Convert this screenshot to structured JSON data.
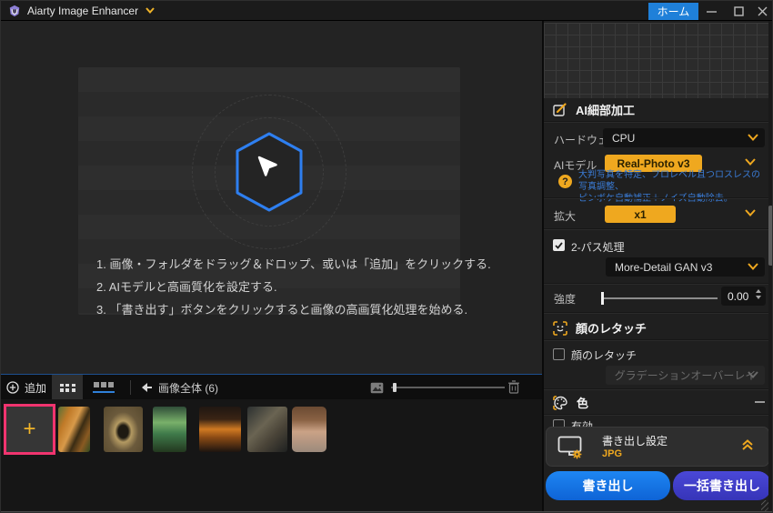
{
  "titlebar": {
    "app_title": "Aiarty Image Enhancer",
    "home_button": "ホーム"
  },
  "dropzone": {
    "instructions": [
      "1. 画像・フォルダをドラッグ＆ドロップ、或いは「追加」をクリックする.",
      "2. AIモデルと高画質化を設定する.",
      "3. 「書き出す」ボタンをクリックすると画像の高画質化処理を始める."
    ]
  },
  "toolbar": {
    "add_label": "追加",
    "view_all_label": "画像全体 (6)"
  },
  "filmstrip": {
    "items": [
      "tiger",
      "butterfly",
      "terrarium-jar",
      "burger",
      "armored-dog",
      "portrait-girl"
    ]
  },
  "sidebar": {
    "ai": {
      "title": "AI細部加工",
      "hardware_label": "ハードウェア",
      "hardware_value": "CPU",
      "model_label": "AIモデル",
      "model_value": "Real-Photo v3",
      "model_hint_line1": "大判写真を特定、プロレベル且つロスレスの写真調整、",
      "model_hint_line2": "ピンボケ自動補正＋ノイズ自動除去。",
      "help_glyph": "?",
      "scale_label": "拡大",
      "scale_value": "x1",
      "two_pass_label": "2-パス処理",
      "two_pass_model": "More-Detail GAN v3",
      "strength_label": "強度",
      "strength_value": "0.00"
    },
    "face": {
      "title": "顔のレタッチ",
      "enable_label": "顔のレタッチ",
      "preset_value": "グラデーションオーバーレイ"
    },
    "color": {
      "title": "色",
      "enable_label": "有効"
    },
    "export": {
      "settings_label": "書き出し設定",
      "format_value": "JPG",
      "export_button": "書き出し",
      "batch_export_button": "一括書き出し"
    }
  },
  "colors": {
    "accent_yellow": "#efa81f",
    "home_blue": "#1f80d9",
    "hint_blue": "#3a7bd5",
    "highlight_pink": "#f1346f",
    "export_button_blue": "#1478ee",
    "batch_button_indigo": "#4544d0",
    "hexagon_blue": "#2e7ff0"
  }
}
